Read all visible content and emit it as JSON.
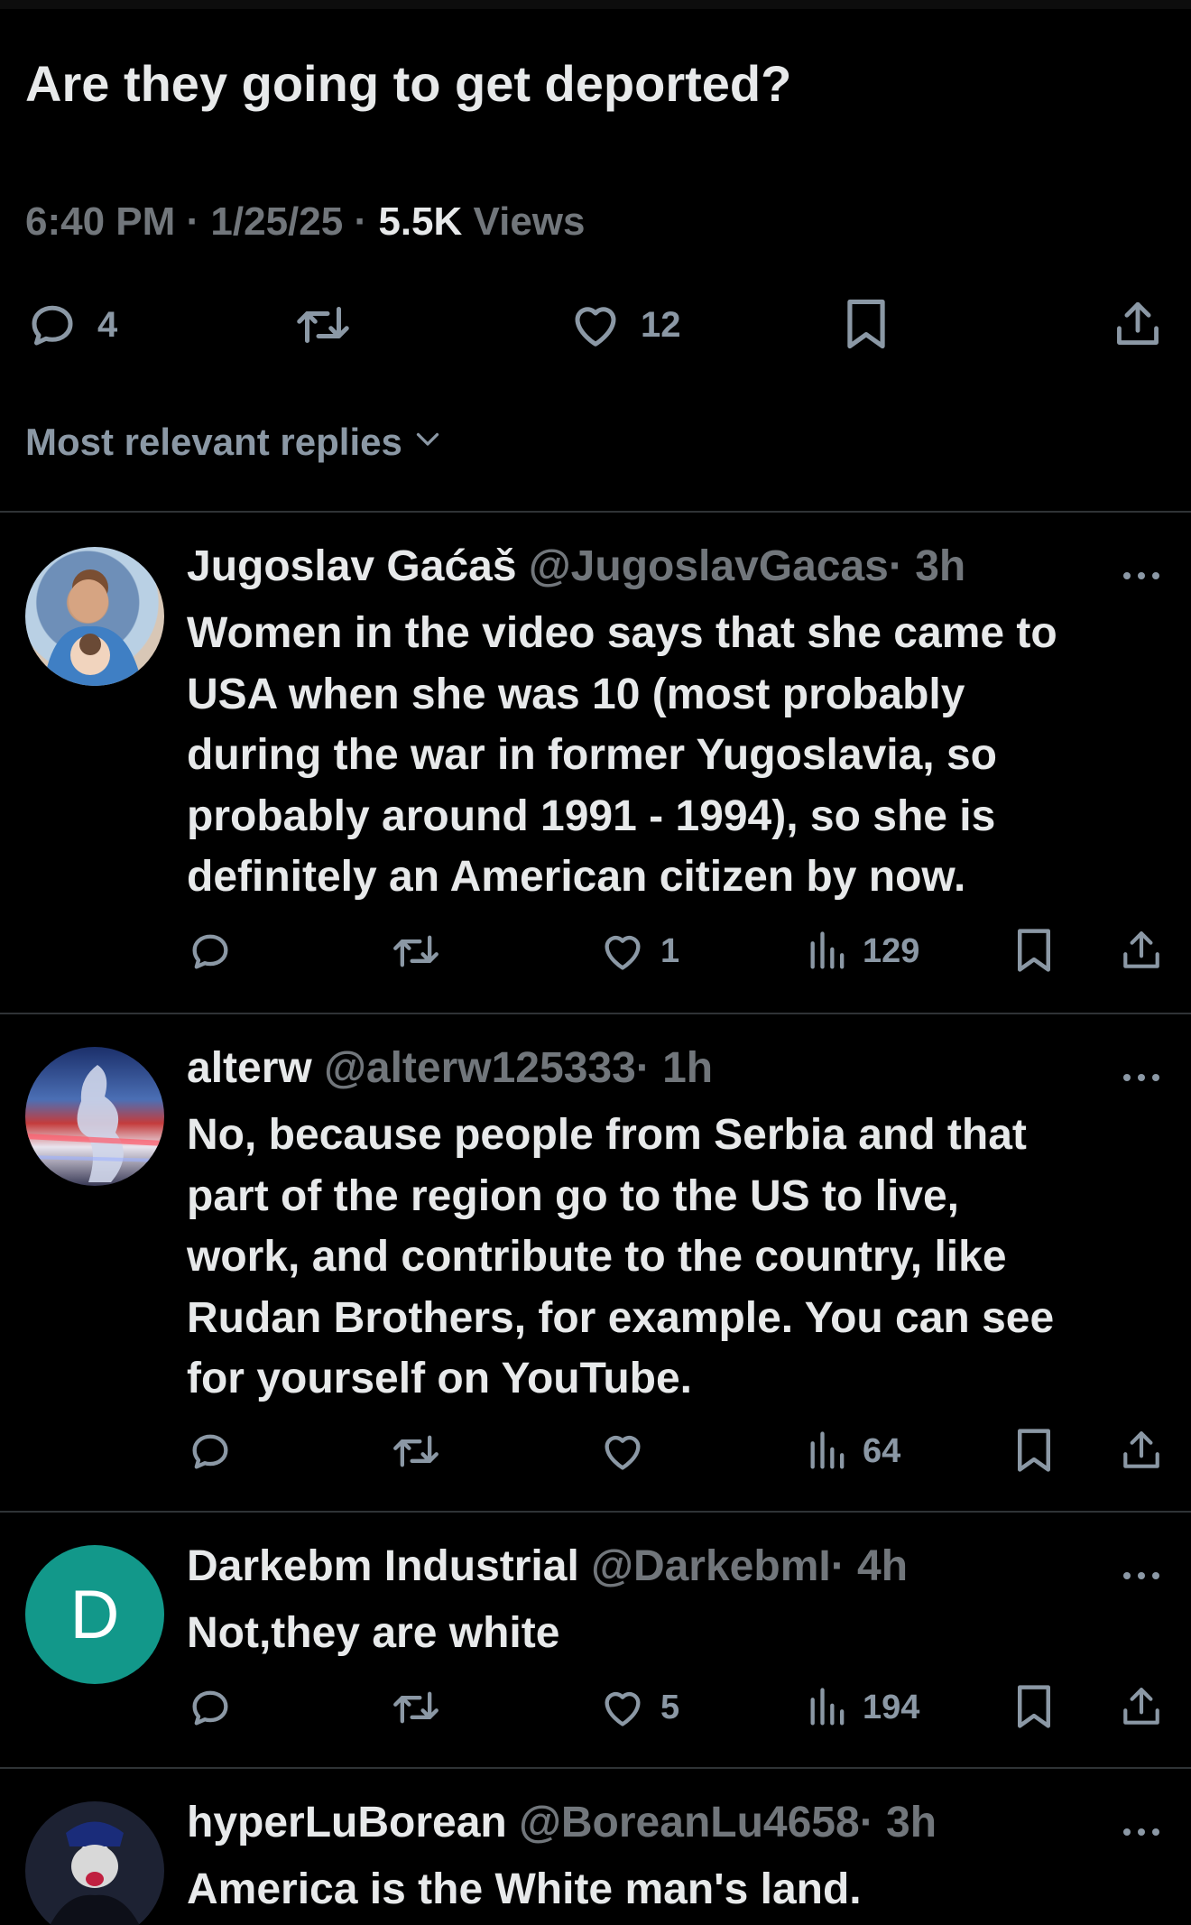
{
  "tweet": {
    "text": "Are they going to get deported?",
    "time": "6:40 PM",
    "date": "1/25/25",
    "views_count": "5.5K",
    "views_label": "Views",
    "sep": "·",
    "stats": {
      "replies": "4",
      "likes": "12"
    }
  },
  "filter": {
    "label": "Most relevant replies",
    "icon": "chevron-down-icon"
  },
  "replies": [
    {
      "name": "Jugoslav Gaćaš",
      "handle": "@JugoslavGacas",
      "time": "· 3h",
      "lines": [
        "Women in the video says that she came to",
        "USA when she was 10 (most probably",
        "during the war in former Yugoslavia, so",
        "probably around 1991 - 1994), so she is",
        "definitely an American citizen by now."
      ],
      "likes": "1",
      "views": "129"
    },
    {
      "name": "alterw",
      "handle": "@alterw125333",
      "time": "· 1h",
      "lines": [
        "No, because people from Serbia and that",
        "part of the region go to the US to live,",
        "work, and contribute to the country, like",
        "Rudan Brothers, for example. You can see",
        "for yourself on YouTube."
      ],
      "likes": "",
      "views": "64"
    },
    {
      "name": "Darkebm Industrial",
      "handle": "@DarkebmI",
      "time": "· 4h",
      "avatar_letter": "D",
      "avatar_color": "#12988a",
      "lines": [
        "Not,they are white"
      ],
      "likes": "5",
      "views": "194"
    },
    {
      "name": "hyperLuBorean",
      "handle": "@BoreanLu4658",
      "time": "· 3h",
      "lines": [
        "America is the White man's land."
      ]
    }
  ],
  "colors": {
    "background": "#000000",
    "text": "#e7e9ea",
    "muted": "#71767b",
    "divider": "#2f3336"
  }
}
